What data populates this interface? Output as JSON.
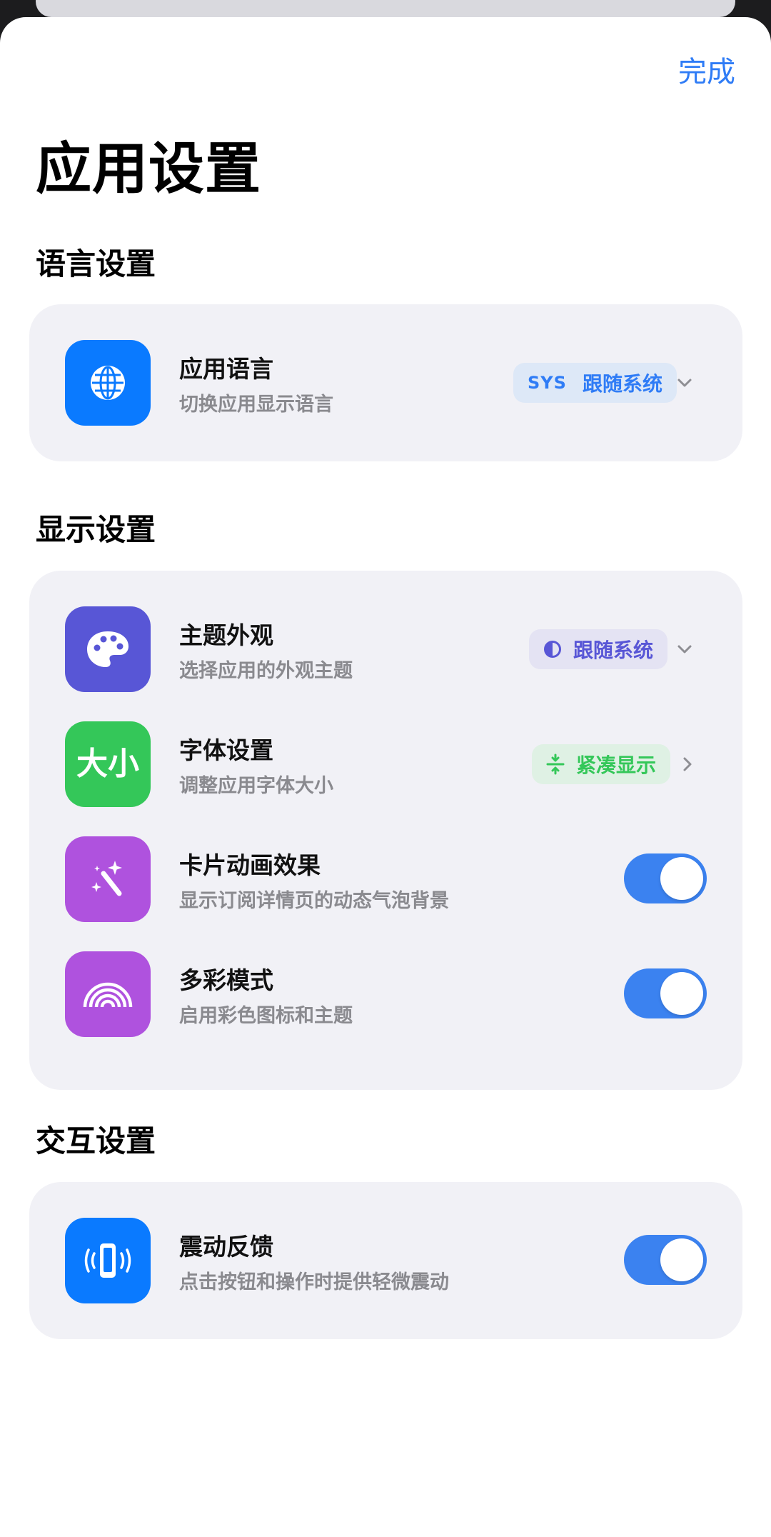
{
  "header": {
    "done_label": "完成",
    "title": "应用设置"
  },
  "sections": [
    {
      "title": "语言设置",
      "rows": [
        {
          "title": "应用语言",
          "subtitle": "切换应用显示语言",
          "icon": "globe-icon",
          "icon_color": "#0a7aff",
          "control": "dropdown",
          "value_code": "SYS",
          "value": "跟随系统"
        }
      ]
    },
    {
      "title": "显示设置",
      "rows": [
        {
          "title": "主题外观",
          "subtitle": "选择应用的外观主题",
          "icon": "palette-icon",
          "icon_color": "#5856d6",
          "control": "dropdown",
          "value_icon": "half-circle-icon",
          "value": "跟随系统"
        },
        {
          "title": "字体设置",
          "subtitle": "调整应用字体大小",
          "icon": "font-size-icon",
          "icon_text": "大小",
          "icon_color": "#34c759",
          "control": "link",
          "value_icon": "compress-icon",
          "value": "紧凑显示"
        },
        {
          "title": "卡片动画效果",
          "subtitle": "显示订阅详情页的动态气泡背景",
          "icon": "magic-wand-icon",
          "icon_color": "#af52de",
          "control": "toggle",
          "on": true
        },
        {
          "title": "多彩模式",
          "subtitle": "启用彩色图标和主题",
          "icon": "rainbow-icon",
          "icon_color": "#af52de",
          "control": "toggle",
          "on": true
        }
      ]
    },
    {
      "title": "交互设置",
      "rows": [
        {
          "title": "震动反馈",
          "subtitle": "点击按钮和操作时提供轻微震动",
          "icon": "phone-vibrate-icon",
          "icon_color": "#0a7aff",
          "control": "toggle",
          "on": true
        }
      ]
    }
  ],
  "colors": {
    "accent": "#2f7cf6",
    "toggle_on": "#3b82f0",
    "card_bg": "#f1f1f6"
  }
}
